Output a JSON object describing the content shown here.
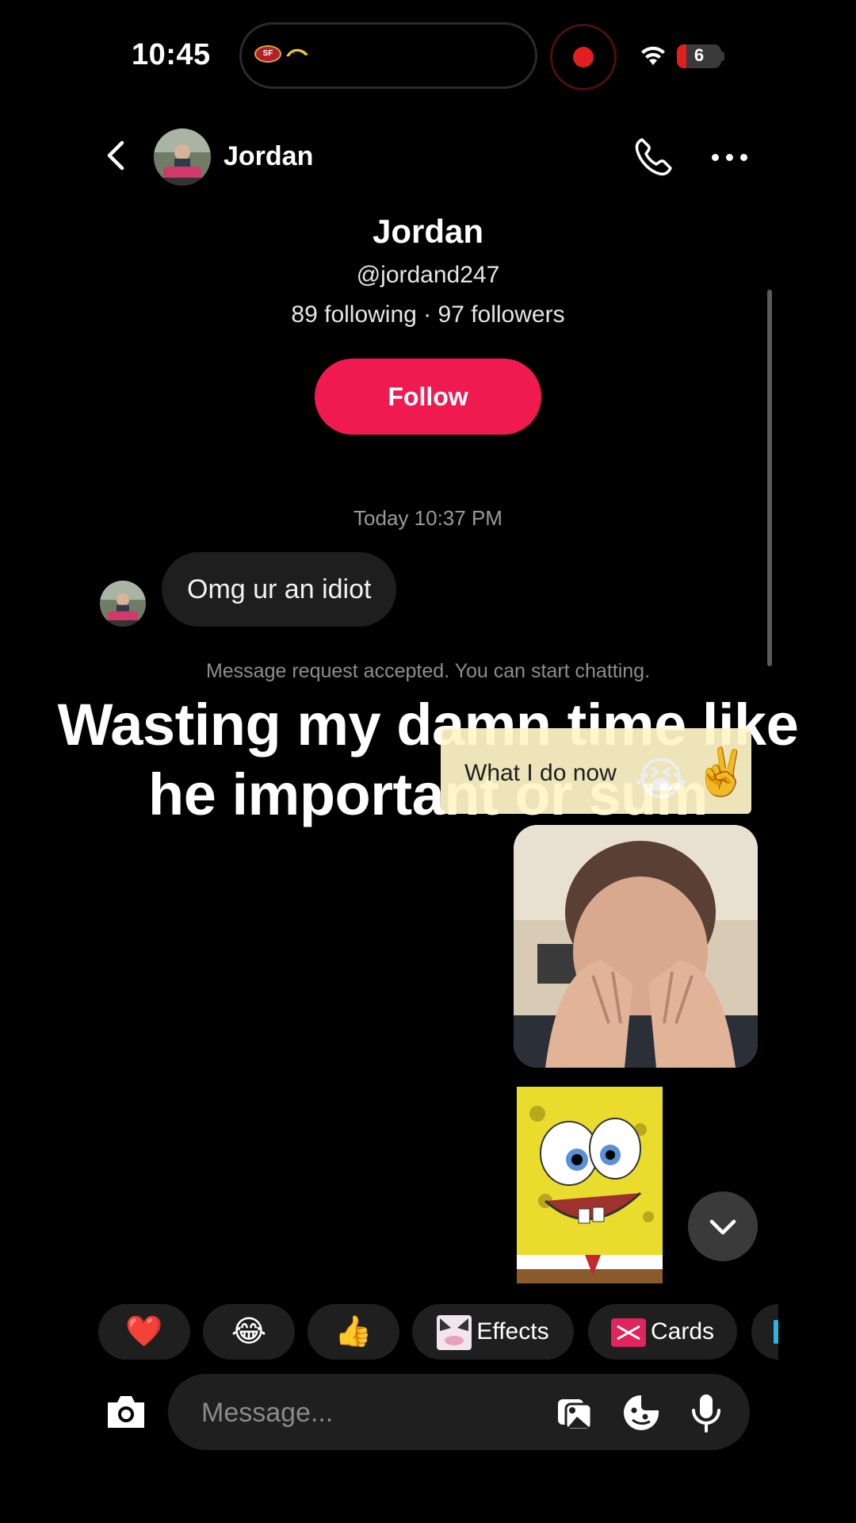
{
  "status_bar": {
    "time": "10:45",
    "battery": "6"
  },
  "header": {
    "contact_name": "Jordan"
  },
  "profile": {
    "name": "Jordan",
    "handle": "@jordand247",
    "stats": "89 following · 97 followers",
    "follow_label": "Follow"
  },
  "chat": {
    "timestamp": "Today 10:37 PM",
    "incoming_message": "Omg ur an idiot",
    "system_notice": "Message request accepted. You can start chatting."
  },
  "overlay": {
    "caption_line1": "Wasting my damn time like",
    "caption_line2": "he important or sum",
    "sticker_text": "What I do now",
    "sticker_emojis": [
      "😭",
      "✌️"
    ]
  },
  "quick_replies": {
    "heart": "❤️",
    "laugh": "😂",
    "thumbs": "👍",
    "effects_label": "Effects",
    "cards_label": "Cards"
  },
  "composer": {
    "placeholder": "Message..."
  },
  "colors": {
    "follow": "#ef1a50",
    "bubble": "#1e1e1e",
    "chip": "#1f1f1f"
  }
}
